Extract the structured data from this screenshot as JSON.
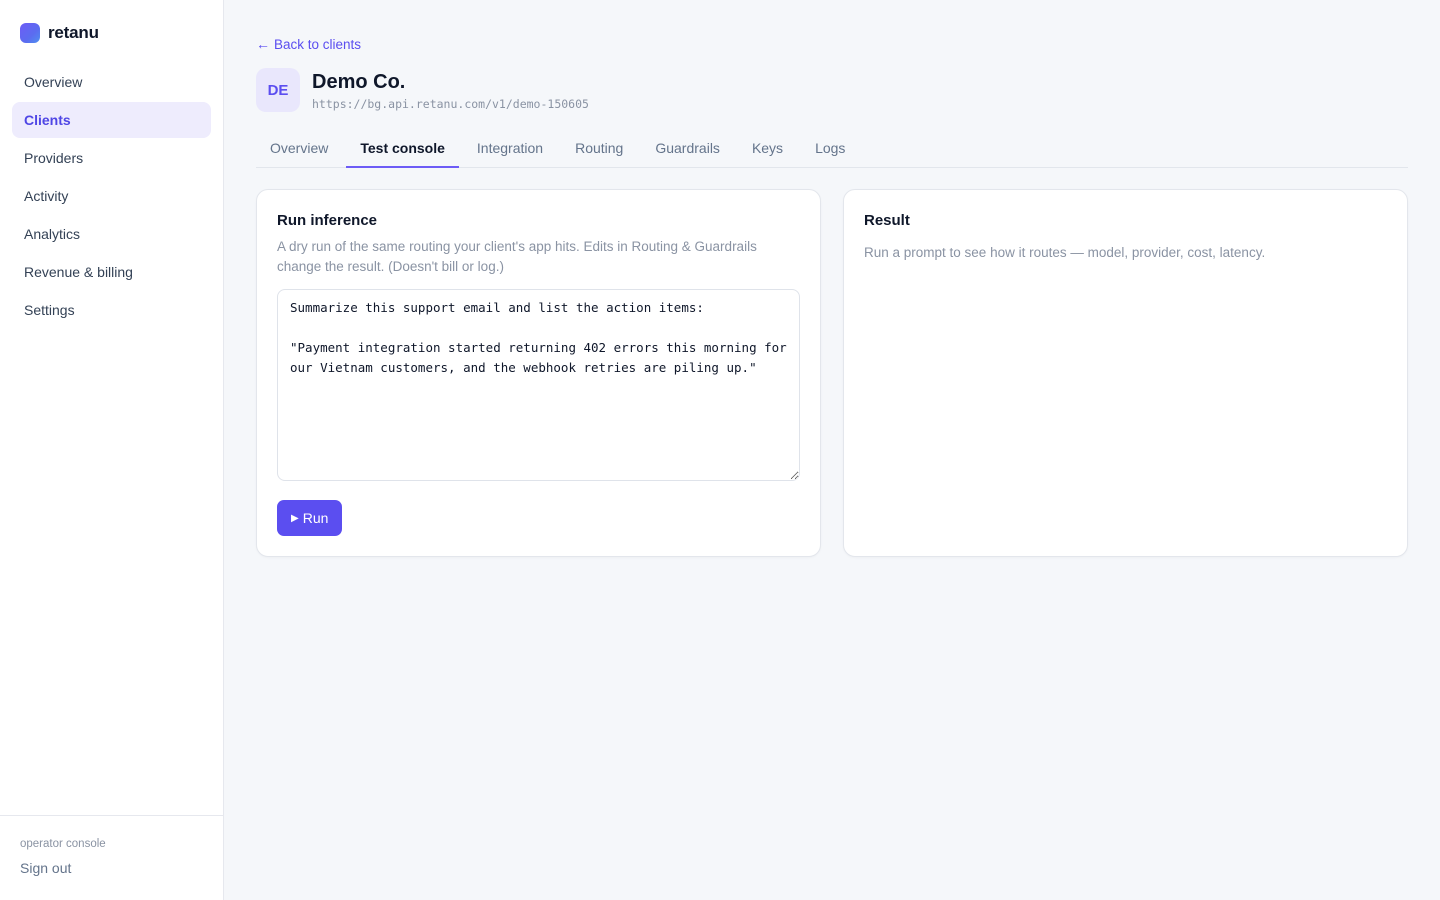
{
  "brand": {
    "name": "retanu"
  },
  "sidebar": {
    "items": [
      {
        "label": "Overview"
      },
      {
        "label": "Clients"
      },
      {
        "label": "Providers"
      },
      {
        "label": "Activity"
      },
      {
        "label": "Analytics"
      },
      {
        "label": "Revenue & billing"
      },
      {
        "label": "Settings"
      }
    ],
    "active_index": 1,
    "footer_label": "operator console",
    "sign_out_label": "Sign out"
  },
  "main": {
    "back_label": "Back to clients",
    "client": {
      "initials": "DE",
      "name": "Demo Co.",
      "url": "https://bg.api.retanu.com/v1/demo-150605"
    },
    "tabs": [
      {
        "label": "Overview"
      },
      {
        "label": "Test console"
      },
      {
        "label": "Integration"
      },
      {
        "label": "Routing"
      },
      {
        "label": "Guardrails"
      },
      {
        "label": "Keys"
      },
      {
        "label": "Logs"
      }
    ],
    "active_tab_index": 1,
    "run_panel": {
      "title": "Run inference",
      "description": "A dry run of the same routing your client's app hits. Edits in Routing & Guardrails change the result. (Doesn't bill or log.)",
      "prompt_value": "Summarize this support email and list the action items:\n\n\"Payment integration started returning 402 errors this morning for our Vietnam customers, and the webhook retries are piling up.\"",
      "run_label": "Run"
    },
    "result_panel": {
      "title": "Result",
      "hint": "Run a prompt to see how it routes — model, provider, cost, latency."
    }
  },
  "colors": {
    "accent": "#5b4ef0",
    "active_nav_bg": "#eeecfd",
    "page_bg": "#f5f7fa"
  },
  "icons": {
    "back": "arrow-left-icon",
    "run": "play-icon",
    "logo": "brand-logo"
  }
}
